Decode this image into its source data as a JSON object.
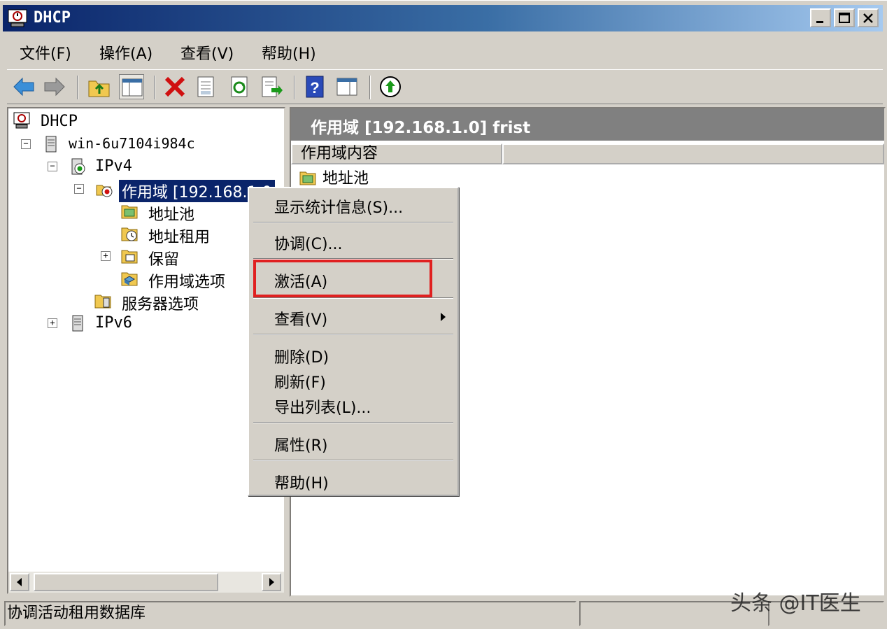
{
  "window": {
    "title": "DHCP"
  },
  "menu": {
    "items": [
      "文件(F)",
      "操作(A)",
      "查看(V)",
      "帮助(H)"
    ]
  },
  "toolbar": {
    "icons": [
      "back-arrow-icon",
      "forward-arrow-icon",
      "up-folder-icon",
      "show-hide-tree-icon",
      "delete-icon",
      "properties-icon",
      "refresh-icon",
      "export-list-icon",
      "help-icon",
      "show-hide-action-icon",
      "activate-icon"
    ]
  },
  "tree": {
    "root": "DHCP",
    "server": "win-6u7104i984c",
    "ipv4": "IPv4",
    "scope": "作用域 [192.168.1.0",
    "pool": "地址池",
    "leases": "地址租用",
    "reservations": "保留",
    "scope_options": "作用域选项",
    "server_options": "服务器选项",
    "ipv6": "IPv6"
  },
  "right": {
    "title": "作用域 [192.168.1.0] frist",
    "column": "作用域内容",
    "item": "地址池"
  },
  "context_menu": {
    "show_stats": "显示统计信息(S)...",
    "reconcile": "协调(C)...",
    "activate": "激活(A)",
    "view": "查看(V)",
    "delete": "删除(D)",
    "refresh": "刷新(F)",
    "export": "导出列表(L)...",
    "properties": "属性(R)",
    "help": "帮助(H)"
  },
  "status": {
    "text": "协调活动租用数据库"
  },
  "watermark": "头条 @IT医生"
}
